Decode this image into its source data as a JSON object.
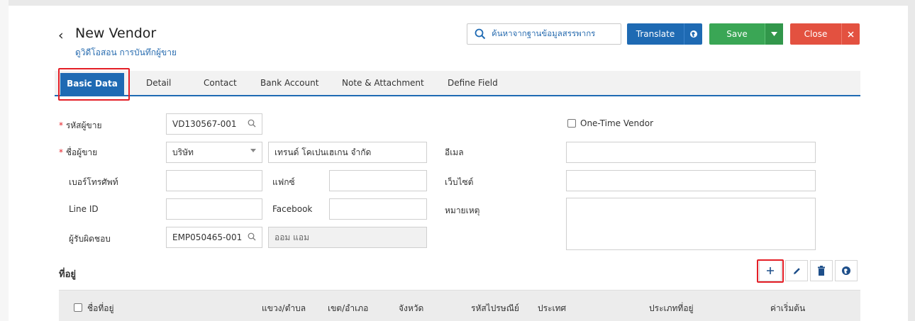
{
  "header": {
    "title": "New Vendor",
    "subtitle": "ดูวิดีโอสอน การบันทึกผู้ขาย"
  },
  "toolbar": {
    "search_label": "ค้นหาจากฐานข้อมูลสรรพากร",
    "translate_label": "Translate",
    "save_label": "Save",
    "close_label": "Close"
  },
  "tabs": [
    {
      "label": "Basic Data",
      "active": true
    },
    {
      "label": "Detail"
    },
    {
      "label": "Contact"
    },
    {
      "label": "Bank Account"
    },
    {
      "label": "Note & Attachment"
    },
    {
      "label": "Define Field"
    }
  ],
  "form": {
    "vendor_code": {
      "label": "รหัสผู้ขาย",
      "value": "VD130567-001"
    },
    "one_time_vendor": {
      "label": "One-Time Vendor",
      "checked": false
    },
    "vendor_name": {
      "label": "ชื่อผู้ขาย",
      "prefix": "บริษัท",
      "value": "เทรนด์ โคเปนเฮเกน จำกัด"
    },
    "email": {
      "label": "อีเมล",
      "value": ""
    },
    "phone": {
      "label": "เบอร์โทรศัพท์",
      "value": ""
    },
    "fax": {
      "label": "แฟกซ์",
      "value": ""
    },
    "website": {
      "label": "เว็บไซต์",
      "value": ""
    },
    "line_id": {
      "label": "Line ID",
      "value": ""
    },
    "facebook": {
      "label": "Facebook",
      "value": ""
    },
    "note": {
      "label": "หมายเหตุ",
      "value": ""
    },
    "responsible": {
      "label": "ผู้รับผิดชอบ",
      "code": "EMP050465-001",
      "name": "ออม แอม"
    }
  },
  "address": {
    "title": "ที่อยู่",
    "columns": [
      "ชื่อที่อยู่",
      "แขวง/ตำบล",
      "เขต/อำเภอ",
      "จังหวัด",
      "รหัสไปรษณีย์",
      "ประเทศ",
      "ประเภทที่อยู่",
      "ค่าเริ่มต้น"
    ]
  },
  "colors": {
    "primary": "#1e6ab3",
    "save": "#3aa655",
    "close": "#e35140",
    "highlight": "#e41e26"
  }
}
